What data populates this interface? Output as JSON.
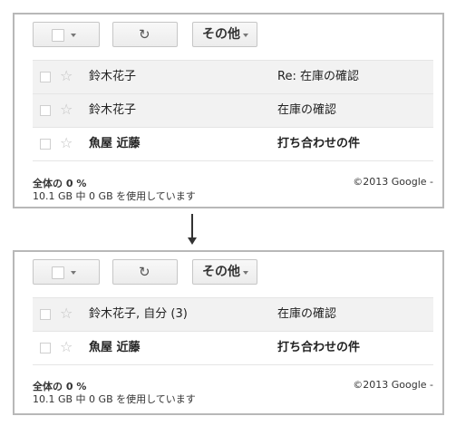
{
  "toolbar": {
    "more_label": "その他",
    "refresh_glyph": "↻",
    "icons": [
      "checkbox-icon",
      "chevron-down-icon",
      "refresh-icon"
    ]
  },
  "before": {
    "rows": [
      {
        "sender": "鈴木花子",
        "subject": "Re: 在庫の確認",
        "unread": false
      },
      {
        "sender": "鈴木花子",
        "subject": "在庫の確認",
        "unread": false
      },
      {
        "sender": "魚屋 近藤",
        "subject": "打ち合わせの件",
        "unread": true
      }
    ]
  },
  "after": {
    "rows": [
      {
        "sender": "鈴木花子, 自分 (3)",
        "subject": "在庫の確認",
        "unread": false
      },
      {
        "sender": "魚屋 近藤",
        "subject": "打ち合わせの件",
        "unread": true
      }
    ]
  },
  "footer": {
    "quota_title": "全体の 0 %",
    "quota_detail": "10.1 GB 中 0 GB を使用しています",
    "copyright": "©2013 Google -"
  }
}
